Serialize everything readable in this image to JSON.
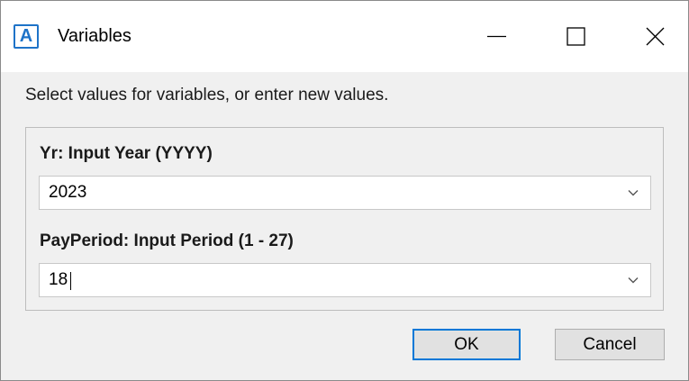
{
  "window": {
    "title": "Variables",
    "app_icon_letter": "A"
  },
  "prompt": "Select values for variables, or enter new values.",
  "fields": [
    {
      "label": "Yr: Input Year (YYYY)",
      "value": "2023"
    },
    {
      "label": "PayPeriod: Input Period (1 - 27)",
      "value": "18"
    }
  ],
  "buttons": {
    "ok_label": "OK",
    "cancel_label": "Cancel"
  },
  "icons": {
    "app": "app-a-icon",
    "minimize": "minimize-icon",
    "maximize": "maximize-icon",
    "close": "close-icon",
    "dropdown": "chevron-down-icon"
  },
  "colors": {
    "accent": "#0078d7",
    "app_icon": "#1e73c8"
  }
}
